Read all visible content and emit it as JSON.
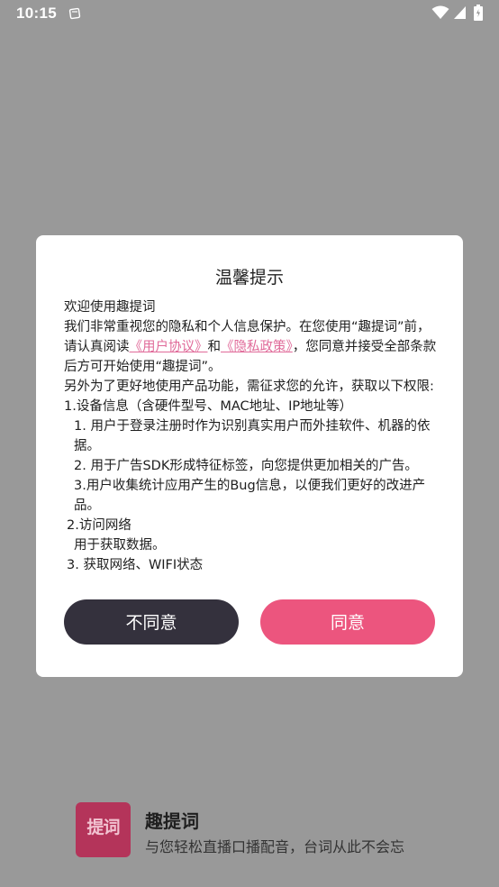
{
  "status_bar": {
    "time": "10:15",
    "icons": [
      "notification-icon",
      "wifi-icon",
      "signal-icon",
      "battery-icon"
    ]
  },
  "dialog": {
    "title": "温馨提示",
    "welcome": "欢迎使用趣提词",
    "p1": "我们非常重视您的隐私和个人信息保护。在您使用“趣提词”前，请认真阅读",
    "link_user_agreement": "《用户协议》",
    "and": "和",
    "link_privacy_policy": "《隐私政策》",
    "p1_tail": "，您同意并接受全部条款后方可开始使用“趣提词”。",
    "p2": "另外为了更好地使用产品功能，需征求您的允许，获取以下权限:",
    "s1_title": "1.设备信息（含硬件型号、MAC地址、IP地址等）",
    "s1_item1": "1. 用户于登录注册时作为识别真实用户而外挂软件、机器的依据。",
    "s1_item2": "2. 用于广告SDK形成特征标签，向您提供更加相关的广告。",
    "s1_item3": "3.用户收集统计应用产生的Bug信息，以便我们更好的改进产品。",
    "s2_title": "2.访问网络",
    "s2_item1": "用于获取数据。",
    "s3_title": "3. 获取网络、WIFI状态",
    "disagree_label": "不同意",
    "agree_label": "同意"
  },
  "app": {
    "logo_text": "提词",
    "name": "趣提词",
    "slogan": "与您轻松直播口播配音，台词从此不会忘"
  },
  "colors": {
    "overlay": "#999999",
    "link": "#e06a99",
    "agree_button": "#ec557e",
    "disagree_button": "#34313d",
    "logo_bg": "#b4345a"
  }
}
